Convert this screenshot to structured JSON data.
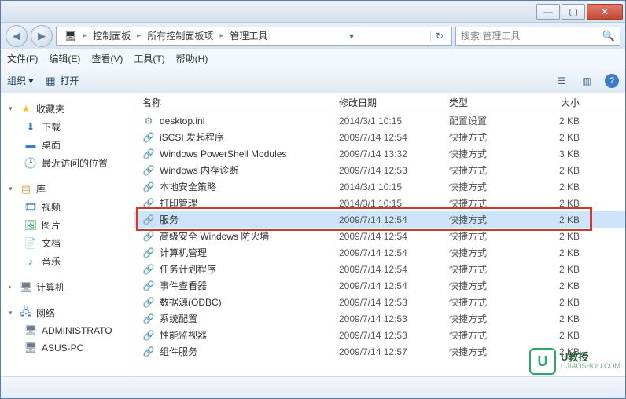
{
  "titlebar": {
    "min": "—",
    "max": "▢",
    "close": "✕"
  },
  "nav": {
    "back": "◀",
    "fwd": "▶"
  },
  "breadcrumb": {
    "segs": [
      "控制面板",
      "所有控制面板项",
      "管理工具"
    ],
    "sep": "▸",
    "root_icon": "🖥",
    "refresh": "↻",
    "dropdown": "▾"
  },
  "search": {
    "placeholder": "搜索 管理工具",
    "icon": "🔍"
  },
  "menu": {
    "file": "文件(F)",
    "edit": "编辑(E)",
    "view": "查看(V)",
    "tools": "工具(T)",
    "help": "帮助(H)"
  },
  "toolbar": {
    "organize": "组织 ▾",
    "open": "打开",
    "open_icon": "▦",
    "view_icon": "☰",
    "help": "?"
  },
  "sidebar": {
    "fav_head": "收藏夹",
    "fav": {
      "downloads": "下载",
      "desktop": "桌面",
      "recent": "最近访问的位置"
    },
    "lib_head": "库",
    "lib": {
      "videos": "视频",
      "pictures": "图片",
      "documents": "文档",
      "music": "音乐"
    },
    "computer_head": "计算机",
    "network_head": "网络",
    "net": {
      "n1": "ADMINISTRATO",
      "n2": "ASUS-PC"
    },
    "tri_open": "▾",
    "tri_closed": "▸"
  },
  "columns": {
    "name": "名称",
    "date": "修改日期",
    "type": "类型",
    "size": "大小"
  },
  "files": [
    {
      "name": "desktop.ini",
      "date": "2014/3/1 10:15",
      "type": "配置设置",
      "size": "2 KB",
      "icon": "ini"
    },
    {
      "name": "iSCSI 发起程序",
      "date": "2009/7/14 12:54",
      "type": "快捷方式",
      "size": "2 KB",
      "icon": "lnk"
    },
    {
      "name": "Windows PowerShell Modules",
      "date": "2009/7/14 13:32",
      "type": "快捷方式",
      "size": "3 KB",
      "icon": "lnk"
    },
    {
      "name": "Windows 内存诊断",
      "date": "2009/7/14 12:53",
      "type": "快捷方式",
      "size": "2 KB",
      "icon": "lnk"
    },
    {
      "name": "本地安全策略",
      "date": "2014/3/1 10:15",
      "type": "快捷方式",
      "size": "2 KB",
      "icon": "lnk"
    },
    {
      "name": "打印管理",
      "date": "2014/3/1 10:15",
      "type": "快捷方式",
      "size": "2 KB",
      "icon": "lnk"
    },
    {
      "name": "服务",
      "date": "2009/7/14 12:54",
      "type": "快捷方式",
      "size": "2 KB",
      "icon": "lnk",
      "selected": true
    },
    {
      "name": "高级安全 Windows 防火墙",
      "date": "2009/7/14 12:54",
      "type": "快捷方式",
      "size": "2 KB",
      "icon": "lnk"
    },
    {
      "name": "计算机管理",
      "date": "2009/7/14 12:54",
      "type": "快捷方式",
      "size": "2 KB",
      "icon": "lnk"
    },
    {
      "name": "任务计划程序",
      "date": "2009/7/14 12:54",
      "type": "快捷方式",
      "size": "2 KB",
      "icon": "lnk"
    },
    {
      "name": "事件查看器",
      "date": "2009/7/14 12:54",
      "type": "快捷方式",
      "size": "2 KB",
      "icon": "lnk"
    },
    {
      "name": "数据源(ODBC)",
      "date": "2009/7/14 12:53",
      "type": "快捷方式",
      "size": "2 KB",
      "icon": "lnk"
    },
    {
      "name": "系统配置",
      "date": "2009/7/14 12:53",
      "type": "快捷方式",
      "size": "2 KB",
      "icon": "lnk"
    },
    {
      "name": "性能监视器",
      "date": "2009/7/14 12:53",
      "type": "快捷方式",
      "size": "2 KB",
      "icon": "lnk"
    },
    {
      "name": "组件服务",
      "date": "2009/7/14 12:57",
      "type": "快捷方式",
      "size": "2 KB",
      "icon": "lnk"
    }
  ],
  "highlight_row_index": 6,
  "watermark": {
    "logo": "U",
    "text": "U教授",
    "sub": "UJIAOSHOU.COM"
  }
}
